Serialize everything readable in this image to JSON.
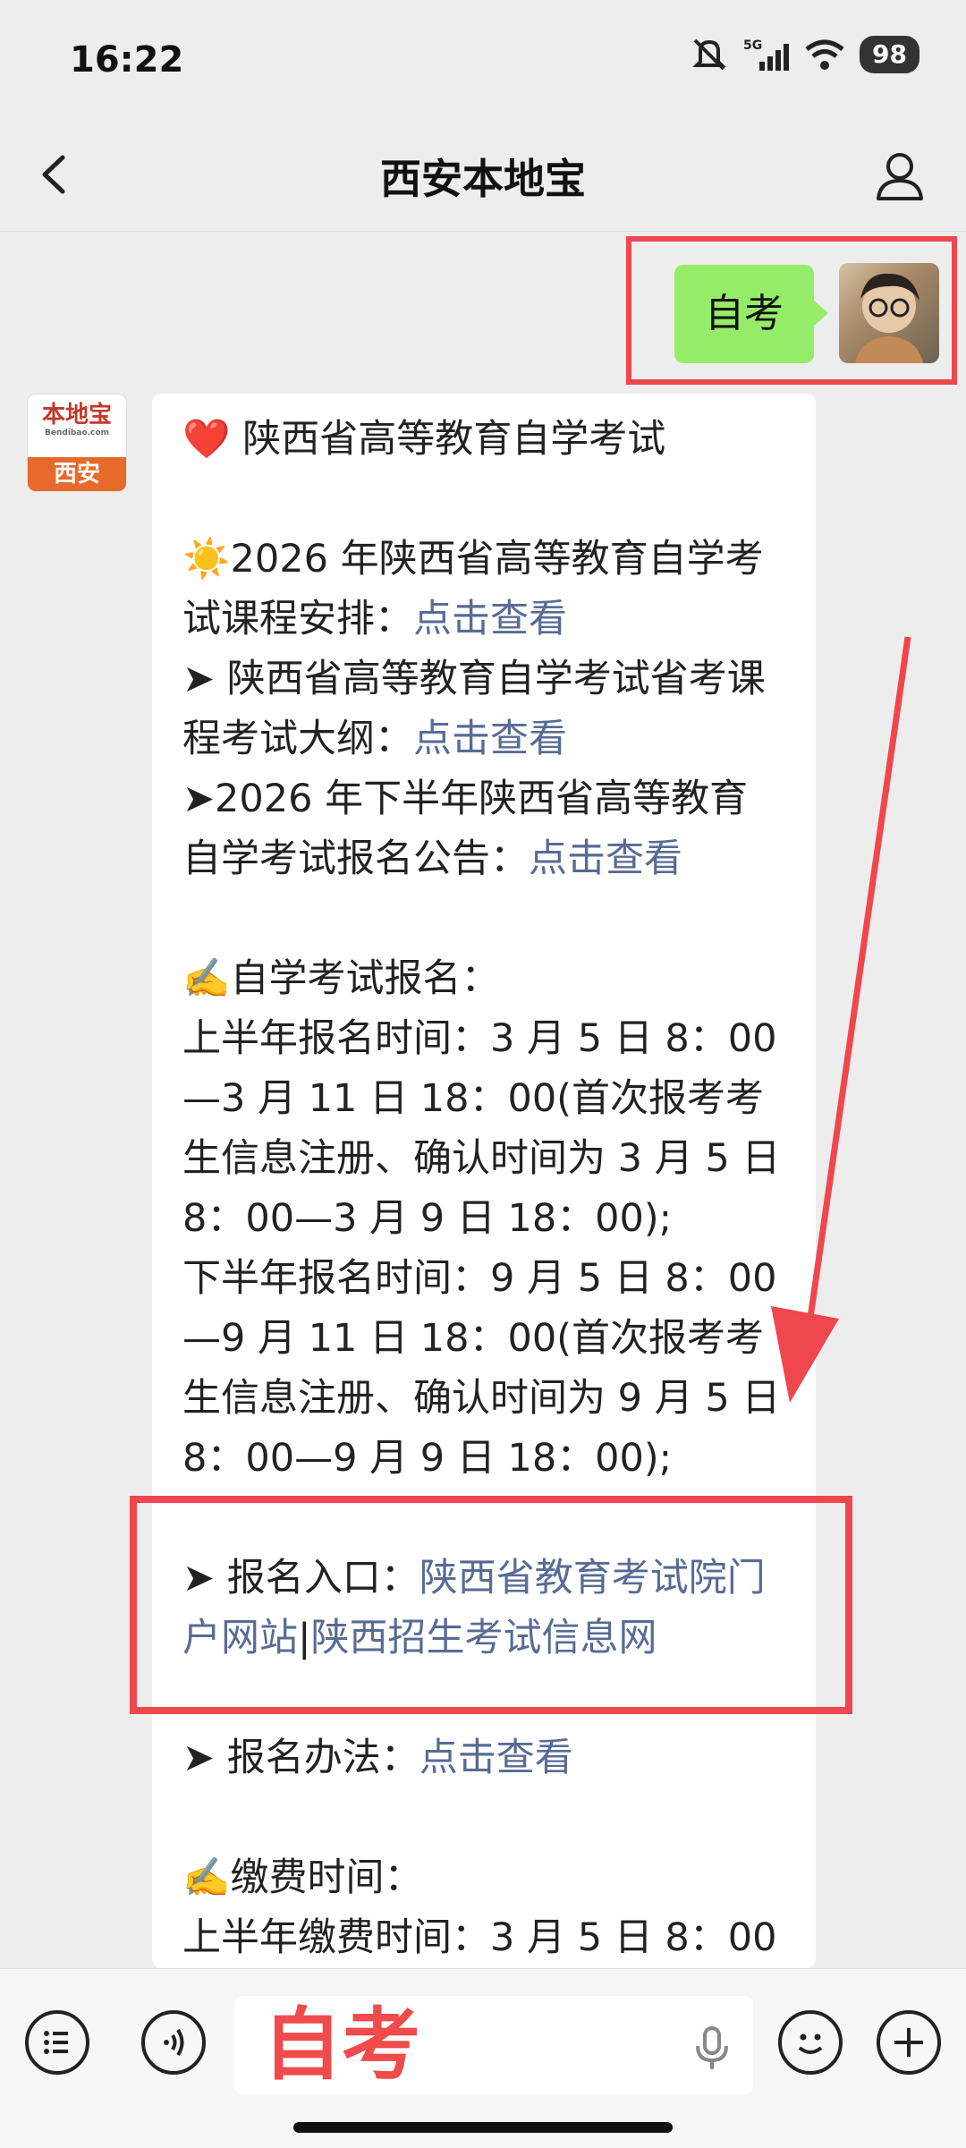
{
  "status_bar": {
    "time": "16:22",
    "network": "5G",
    "battery": "98"
  },
  "title_bar": {
    "title": "西安本地宝"
  },
  "sent_message": {
    "text": "自考"
  },
  "bot_avatar": {
    "brand": "本地宝",
    "site": "Bendibao.com",
    "city": "西安"
  },
  "message": {
    "title": "陕西省高等教育自学考试",
    "line1_prefix": "2026 年陕西省高等教育自学考试课程安排：",
    "line1_link": "点击查看",
    "line2_prefix": "➤ 陕西省高等教育自学考试省考课程考试大纲：",
    "line2_link": "点击查看",
    "line3_prefix": "➤2026 年下半年陕西省高等教育自学考试报名公告：",
    "line3_link": "点击查看",
    "reg_heading": "自学考试报名：",
    "reg_first": "上半年报名时间：3 月 5 日 8：00—3 月 11 日 18：00(首次报考考生信息注册、确认时间为 3 月 5 日 8：00—3 月 9 日 18：00);",
    "reg_second": "下半年报名时间：9 月 5 日 8：00—9 月 11 日 18：00(首次报考考生信息注册、确认时间为 9 月 5 日 8：00—9 月 9 日 18：00);",
    "entry_prefix": "➤ 报名入口：",
    "entry_link1": "陕西省教育考试院门户网站",
    "entry_sep": "|",
    "entry_link2": "陕西招生考试信息网",
    "method_prefix": "➤ 报名办法：",
    "method_link": "点击查看",
    "fee_heading": "缴费时间：",
    "fee_first": "上半年缴费时间：3 月 5 日 8：00"
  },
  "input_bar": {
    "text": "自考"
  },
  "colors": {
    "link": "#576b95",
    "annotation": "#f0464d",
    "sent_bubble": "#95ec69"
  }
}
